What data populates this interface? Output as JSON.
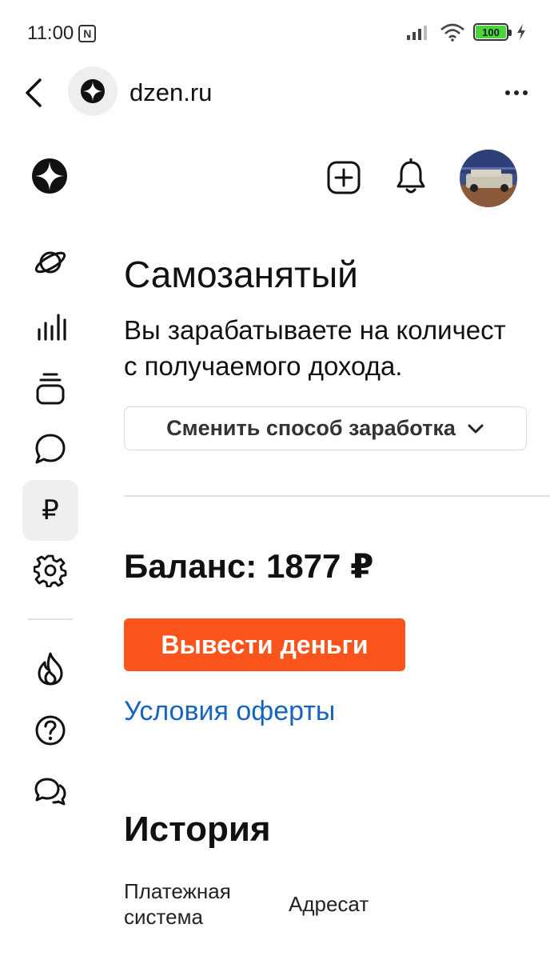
{
  "status_bar": {
    "time": "11:00",
    "nfc_glyph": "N",
    "battery_level": "100",
    "icons": [
      "nfc-icon",
      "signal-icon",
      "wifi-icon",
      "battery-icon",
      "charging-icon"
    ]
  },
  "browser": {
    "domain": "dzen.ru",
    "icons": [
      "back-icon",
      "site-logo-icon",
      "more-icon"
    ]
  },
  "header": {
    "icons": [
      "dzen-logo-icon",
      "create-icon",
      "bell-icon",
      "avatar"
    ]
  },
  "sidebar": {
    "items": [
      {
        "icon": "planet-icon"
      },
      {
        "icon": "stats-icon"
      },
      {
        "icon": "layers-icon"
      },
      {
        "icon": "chat-icon"
      },
      {
        "icon": "rouble-icon",
        "glyph": "₽",
        "active": true
      },
      {
        "icon": "gear-icon"
      },
      {
        "icon": "fire-icon"
      },
      {
        "icon": "help-icon"
      },
      {
        "icon": "messages-icon"
      }
    ]
  },
  "main": {
    "title": "Самозанятый",
    "description": "Вы зарабатываете на количест\nс получаемого дохода.",
    "change_method_label": "Сменить способ заработка",
    "balance": "Баланс: 1877 ₽",
    "withdraw_label": "Вывести деньги",
    "offer_link": "Условия оферты",
    "history_title": "История",
    "table_headers": [
      "Платежная система",
      "Адресат"
    ]
  },
  "colors": {
    "accent": "#fa541c",
    "link": "#1565c0",
    "active_bg": "#efefef",
    "battery": "#4cd43a"
  }
}
